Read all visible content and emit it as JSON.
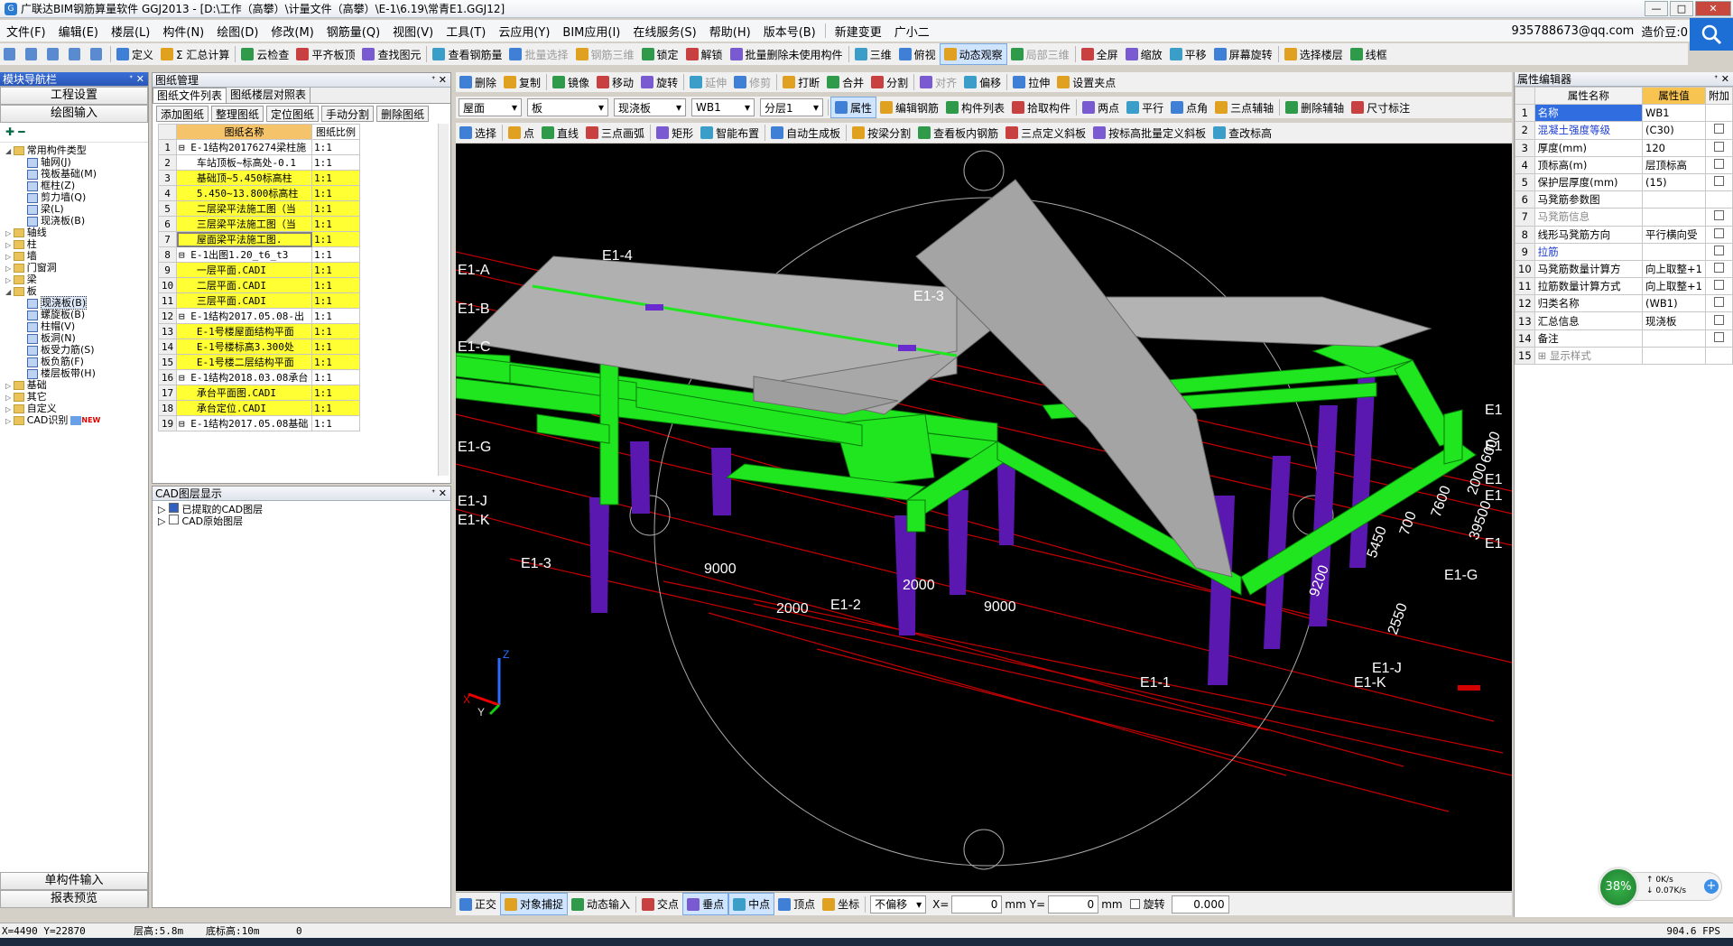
{
  "window": {
    "title": "广联达BIM钢筋算量软件 GGJ2013 - [D:\\工作（高攀）\\计量文件（高攀）\\E-1\\6.19\\常青E1.GGJ12]",
    "buttons": [
      "—",
      "□",
      "✕"
    ]
  },
  "menu": {
    "items": [
      "文件(F)",
      "编辑(E)",
      "楼层(L)",
      "构件(N)",
      "绘图(D)",
      "修改(M)",
      "钢筋量(Q)",
      "视图(V)",
      "工具(T)",
      "云应用(Y)",
      "BIM应用(I)",
      "在线服务(S)",
      "帮助(H)",
      "版本号(B)"
    ],
    "new_change": "新建变更",
    "guang_xiaoer": "广小二",
    "account": "935788673@qq.com",
    "price_beans": "造价豆:0"
  },
  "toolbar1": {
    "items": [
      "定义",
      "Σ 汇总计算",
      "云检查",
      "平齐板顶",
      "查找图元",
      "查看钢筋量",
      "批量选择",
      "钢筋三维",
      "锁定",
      "解锁",
      "批量删除未使用构件",
      "三维",
      "俯视",
      "动态观察",
      "局部三维",
      "全屏",
      "缩放",
      "平移",
      "屏幕旋转",
      "选择楼层",
      "线框"
    ]
  },
  "toolbar2": {
    "items": [
      "删除",
      "复制",
      "镜像",
      "移动",
      "旋转",
      "延伸",
      "修剪",
      "打断",
      "合并",
      "分割",
      "对齐",
      "偏移",
      "拉伸",
      "设置夹点"
    ]
  },
  "toolbar3": {
    "selects": [
      "屋面",
      "板",
      "现浇板",
      "WB1",
      "分层1"
    ],
    "items": [
      "属性",
      "编辑钢筋",
      "构件列表",
      "拾取构件",
      "两点",
      "平行",
      "点角",
      "三点辅轴",
      "删除辅轴",
      "尺寸标注"
    ]
  },
  "toolbar4": {
    "items": [
      "选择",
      "点",
      "直线",
      "三点画弧",
      "矩形",
      "智能布置",
      "自动生成板",
      "按梁分割",
      "查看板内钢筋",
      "三点定义斜板",
      "按标高批量定义斜板",
      "查改标高"
    ]
  },
  "module_nav": {
    "title": "模块导航栏",
    "buttons": [
      "工程设置",
      "绘图输入"
    ],
    "bottom_buttons": [
      "单构件输入",
      "报表预览"
    ],
    "tree": [
      {
        "label": "常用构件类型",
        "level": 0,
        "type": "folder",
        "exp": "−"
      },
      {
        "label": "轴网(J)",
        "level": 1,
        "type": "item"
      },
      {
        "label": "筏板基础(M)",
        "level": 1,
        "type": "item"
      },
      {
        "label": "框柱(Z)",
        "level": 1,
        "type": "item"
      },
      {
        "label": "剪力墙(Q)",
        "level": 1,
        "type": "item"
      },
      {
        "label": "梁(L)",
        "level": 1,
        "type": "item"
      },
      {
        "label": "现浇板(B)",
        "level": 1,
        "type": "item"
      },
      {
        "label": "轴线",
        "level": 0,
        "type": "folder",
        "exp": "+"
      },
      {
        "label": "柱",
        "level": 0,
        "type": "folder",
        "exp": "+"
      },
      {
        "label": "墙",
        "level": 0,
        "type": "folder",
        "exp": "+"
      },
      {
        "label": "门窗洞",
        "level": 0,
        "type": "folder",
        "exp": "+"
      },
      {
        "label": "梁",
        "level": 0,
        "type": "folder",
        "exp": "+"
      },
      {
        "label": "板",
        "level": 0,
        "type": "folder",
        "exp": "−"
      },
      {
        "label": "现浇板(B)",
        "level": 1,
        "type": "item",
        "selected": true
      },
      {
        "label": "螺旋板(B)",
        "level": 1,
        "type": "item"
      },
      {
        "label": "柱帽(V)",
        "level": 1,
        "type": "item"
      },
      {
        "label": "板洞(N)",
        "level": 1,
        "type": "item"
      },
      {
        "label": "板受力筋(S)",
        "level": 1,
        "type": "item"
      },
      {
        "label": "板负筋(F)",
        "level": 1,
        "type": "item"
      },
      {
        "label": "楼层板带(H)",
        "level": 1,
        "type": "item"
      },
      {
        "label": "基础",
        "level": 0,
        "type": "folder",
        "exp": "+"
      },
      {
        "label": "其它",
        "level": 0,
        "type": "folder",
        "exp": "+"
      },
      {
        "label": "自定义",
        "level": 0,
        "type": "folder",
        "exp": "+"
      },
      {
        "label": "CAD识别",
        "level": 0,
        "type": "folder",
        "exp": "+",
        "badge": "NEW"
      }
    ]
  },
  "drawing_mgr": {
    "title": "图纸管理",
    "tabs": [
      "图纸文件列表",
      "图纸楼层对照表"
    ],
    "buttons": [
      "添加图纸",
      "整理图纸",
      "定位图纸",
      "手动分割",
      "删除图纸"
    ],
    "headers": [
      "图纸名称",
      "图纸比例"
    ],
    "rows": [
      {
        "n": "1",
        "name": "⊟ E-1结构20176274梁柱施",
        "scale": "1:1",
        "y": false
      },
      {
        "n": "2",
        "name": "   车站顶板~标高处-0.1",
        "scale": "1:1",
        "y": false
      },
      {
        "n": "3",
        "name": "   基础顶~5.450标高柱",
        "scale": "1:1",
        "y": true
      },
      {
        "n": "4",
        "name": "   5.450~13.800标高柱",
        "scale": "1:1",
        "y": true
      },
      {
        "n": "5",
        "name": "   二层梁平法施工图（当",
        "scale": "1:1",
        "y": true
      },
      {
        "n": "6",
        "name": "   三层梁平法施工图（当",
        "scale": "1:1",
        "y": true
      },
      {
        "n": "7",
        "name": "   屋面梁平法施工图.",
        "scale": "1:1",
        "y": true,
        "sel": true
      },
      {
        "n": "8",
        "name": "⊟ E-1出图1.20_t6_t3",
        "scale": "1:1",
        "y": false
      },
      {
        "n": "9",
        "name": "   一层平面.CADI",
        "scale": "1:1",
        "y": true
      },
      {
        "n": "10",
        "name": "   二层平面.CADI",
        "scale": "1:1",
        "y": true
      },
      {
        "n": "11",
        "name": "   三层平面.CADI",
        "scale": "1:1",
        "y": true
      },
      {
        "n": "12",
        "name": "⊟ E-1结构2017.05.08-出",
        "scale": "1:1",
        "y": false
      },
      {
        "n": "13",
        "name": "   E-1号楼屋面结构平面",
        "scale": "1:1",
        "y": true
      },
      {
        "n": "14",
        "name": "   E-1号楼标高3.300处",
        "scale": "1:1",
        "y": true
      },
      {
        "n": "15",
        "name": "   E-1号楼二层结构平面",
        "scale": "1:1",
        "y": true
      },
      {
        "n": "16",
        "name": "⊟ E-1结构2018.03.08承台",
        "scale": "1:1",
        "y": false
      },
      {
        "n": "17",
        "name": "   承台平面图.CADI",
        "scale": "1:1",
        "y": true
      },
      {
        "n": "18",
        "name": "   承台定位.CADI",
        "scale": "1:1",
        "y": true
      },
      {
        "n": "19",
        "name": "⊟ E-1结构2017.05.08基础",
        "scale": "1:1",
        "y": false
      }
    ]
  },
  "cad_layers": {
    "title": "CAD图层显示",
    "items": [
      "已提取的CAD图层",
      "CAD原始图层"
    ]
  },
  "props": {
    "title": "属性编辑器",
    "headers": [
      "属性名称",
      "属性值",
      "附加"
    ],
    "rows": [
      {
        "n": "1",
        "name": "名称",
        "val": "WB1",
        "cls": "",
        "chk": false,
        "sel": true
      },
      {
        "n": "2",
        "name": "混凝土强度等级",
        "val": "(C30)",
        "cls": "blue",
        "chk": true
      },
      {
        "n": "3",
        "name": "厚度(mm)",
        "val": "120",
        "cls": "",
        "chk": true
      },
      {
        "n": "4",
        "name": "顶标高(m)",
        "val": "层顶标高",
        "cls": "",
        "chk": true
      },
      {
        "n": "5",
        "name": "保护层厚度(mm)",
        "val": "(15)",
        "cls": "",
        "chk": true
      },
      {
        "n": "6",
        "name": "马凳筋参数图",
        "val": "",
        "cls": "",
        "chk": false
      },
      {
        "n": "7",
        "name": "马凳筋信息",
        "val": "",
        "cls": "gray",
        "chk": true
      },
      {
        "n": "8",
        "name": "线形马凳筋方向",
        "val": "平行横向受",
        "cls": "",
        "chk": true
      },
      {
        "n": "9",
        "name": "拉筋",
        "val": "",
        "cls": "blue",
        "chk": true
      },
      {
        "n": "10",
        "name": "马凳筋数量计算方",
        "val": "向上取整+1",
        "cls": "",
        "chk": true
      },
      {
        "n": "11",
        "name": "拉筋数量计算方式",
        "val": "向上取整+1",
        "cls": "",
        "chk": true
      },
      {
        "n": "12",
        "name": "归类名称",
        "val": "(WB1)",
        "cls": "",
        "chk": true
      },
      {
        "n": "13",
        "name": "汇总信息",
        "val": "现浇板",
        "cls": "",
        "chk": true
      },
      {
        "n": "14",
        "name": "备注",
        "val": "",
        "cls": "",
        "chk": true
      },
      {
        "n": "15",
        "name": "⊞ 显示样式",
        "val": "",
        "cls": "gray",
        "chk": false
      }
    ]
  },
  "viewport": {
    "axis_labels": [
      "E1-A",
      "E1-B",
      "E1-C",
      "E1-G",
      "E1-J",
      "E1-K",
      "E1-4",
      "E1-3",
      "E1-3",
      "E1-2",
      "E1-1",
      "E1-J",
      "E1-K",
      "E1-G",
      "E1",
      "E1",
      "E1",
      "E1",
      "E1"
    ],
    "dims": [
      "9000",
      "2000",
      "2000",
      "9000",
      "2550",
      "9200",
      "5450",
      "700",
      "7600",
      "2000",
      "6000",
      "39500"
    ],
    "axes": [
      "Z",
      "Y",
      "X"
    ]
  },
  "snapbar": {
    "items": [
      "正交",
      "对象捕捉",
      "动态输入",
      "交点",
      "垂点",
      "中点",
      "顶点",
      "坐标"
    ],
    "offset": "不偏移",
    "x_label": "X=",
    "x_val": "0",
    "y_label": "Y=",
    "y_val": "0",
    "unit": "mm",
    "rotate_label": "旋转",
    "rotate_val": "0.000"
  },
  "netmon": {
    "percent": "38%",
    "up": "0K/s",
    "down": "0.07K/s"
  },
  "status": {
    "coords": "X=4490 Y=22870",
    "floor_h": "层高:5.8m",
    "bottom_elev": "底标高:10m",
    "extra": "0",
    "fps": "904.6 FPS"
  },
  "colors": {
    "green": "#1fe61f",
    "purple": "#5a18b0",
    "slab": "#a9a9a9",
    "red_axis": "#d40000"
  }
}
